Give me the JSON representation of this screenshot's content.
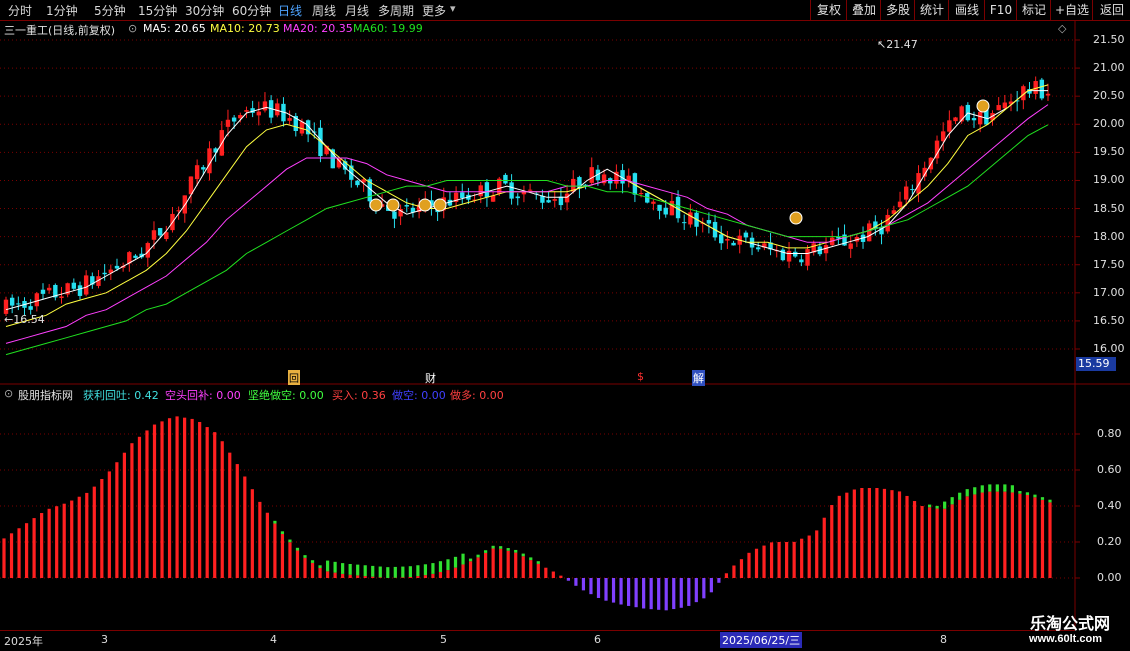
{
  "toolbar": {
    "periods": [
      "分时",
      "1分钟",
      "5分钟",
      "15分钟",
      "30分钟",
      "60分钟",
      "日线",
      "周线",
      "月线",
      "多周期",
      "更多"
    ],
    "active_period": "日线",
    "buttons": [
      "复权",
      "叠加",
      "多股",
      "统计",
      "画线",
      "F10",
      "标记",
      "+自选",
      "返回"
    ]
  },
  "main_legend": {
    "title": "三一重工(日线,前复权)",
    "ma5": "MA5: 20.65",
    "ma10": "MA10: 20.73",
    "ma20": "MA20: 20.35",
    "ma60": "MA60: 19.99"
  },
  "colors": {
    "up": "#ff2020",
    "down": "#26e0f0",
    "ma5": "#ffffff",
    "ma10": "#ffff40",
    "ma20": "#ff40ff",
    "ma60": "#20e020",
    "grid": "#7a0000",
    "axis_text": "#e0e0e0"
  },
  "price_axis": {
    "ticks": [
      "21.50",
      "21.00",
      "20.50",
      "20.00",
      "19.50",
      "19.00",
      "18.50",
      "18.00",
      "17.50",
      "17.00",
      "16.50",
      "16.00"
    ],
    "current_price": "15.59"
  },
  "annotations": {
    "high": "21.47",
    "low": "16.54",
    "events": [
      "回",
      "财",
      "$",
      "解"
    ]
  },
  "sub_legend": {
    "name": "股朋指标网",
    "f1": "获利回吐: 0.42",
    "f2": "空头回补: 0.00",
    "f3": "坚绝做空: 0.00",
    "f4": "买入: 0.36",
    "f5": "做空: 0.00",
    "f6": "做多: 0.00"
  },
  "sub_axis": {
    "ticks": [
      "0.80",
      "0.60",
      "0.40",
      "0.20",
      "0.00"
    ]
  },
  "date_axis": {
    "labels": [
      "2025年",
      "3",
      "4",
      "5",
      "6",
      "8"
    ],
    "cursor": "2025/06/25/三"
  },
  "watermark": {
    "title": "乐淘公式网",
    "url": "www.60lt.com"
  },
  "chart_data": {
    "type": "candlestick",
    "price_ylim": [
      16.0,
      21.5
    ],
    "series": [
      {
        "name": "MA5",
        "values": [
          16.7,
          16.8,
          16.9,
          17.0,
          17.1,
          17.3,
          17.5,
          17.7,
          18.1,
          18.6,
          19.2,
          19.8,
          20.2,
          20.3,
          20.2,
          20.0,
          19.6,
          19.2,
          18.9,
          18.6,
          18.4,
          18.5,
          18.6,
          18.7,
          18.8,
          18.9,
          18.8,
          18.7,
          18.7,
          19.0,
          19.2,
          19.0,
          18.8,
          18.6,
          18.4,
          18.2,
          18.0,
          17.9,
          17.8,
          17.7,
          17.7,
          17.8,
          17.9,
          18.0,
          18.2,
          18.6,
          19.2,
          19.8,
          20.2,
          20.1,
          20.3,
          20.6,
          20.6
        ]
      },
      {
        "name": "MA10",
        "values": [
          16.4,
          16.5,
          16.6,
          16.8,
          16.9,
          17.0,
          17.2,
          17.4,
          17.7,
          18.1,
          18.6,
          19.1,
          19.6,
          19.9,
          20.0,
          19.9,
          19.6,
          19.3,
          19.0,
          18.8,
          18.6,
          18.5,
          18.5,
          18.6,
          18.7,
          18.8,
          18.8,
          18.8,
          18.8,
          18.9,
          19.0,
          19.0,
          18.8,
          18.6,
          18.4,
          18.2,
          18.0,
          17.9,
          17.9,
          17.8,
          17.8,
          17.9,
          18.0,
          18.1,
          18.3,
          18.6,
          18.9,
          19.3,
          19.8,
          20.0,
          20.3,
          20.6,
          20.7
        ]
      },
      {
        "name": "MA20",
        "values": [
          16.1,
          16.2,
          16.3,
          16.4,
          16.6,
          16.7,
          16.9,
          17.1,
          17.3,
          17.6,
          17.9,
          18.3,
          18.6,
          18.9,
          19.2,
          19.4,
          19.4,
          19.4,
          19.3,
          19.1,
          19.0,
          18.9,
          18.8,
          18.8,
          18.8,
          18.8,
          18.8,
          18.8,
          18.9,
          18.9,
          19.0,
          19.0,
          18.9,
          18.8,
          18.7,
          18.5,
          18.4,
          18.2,
          18.1,
          18.0,
          17.9,
          17.9,
          18.0,
          18.1,
          18.2,
          18.4,
          18.6,
          18.9,
          19.2,
          19.5,
          19.8,
          20.1,
          20.35
        ]
      },
      {
        "name": "MA60",
        "values": [
          15.9,
          16.0,
          16.1,
          16.2,
          16.3,
          16.4,
          16.5,
          16.7,
          16.8,
          17.0,
          17.2,
          17.4,
          17.7,
          17.9,
          18.1,
          18.3,
          18.5,
          18.6,
          18.7,
          18.8,
          18.9,
          18.9,
          19.0,
          19.0,
          19.0,
          19.0,
          19.0,
          19.0,
          18.9,
          18.9,
          18.8,
          18.8,
          18.7,
          18.6,
          18.5,
          18.4,
          18.3,
          18.2,
          18.1,
          18.0,
          18.0,
          18.0,
          18.0,
          18.1,
          18.2,
          18.3,
          18.5,
          18.7,
          18.9,
          19.2,
          19.5,
          19.8,
          19.99
        ]
      }
    ]
  }
}
